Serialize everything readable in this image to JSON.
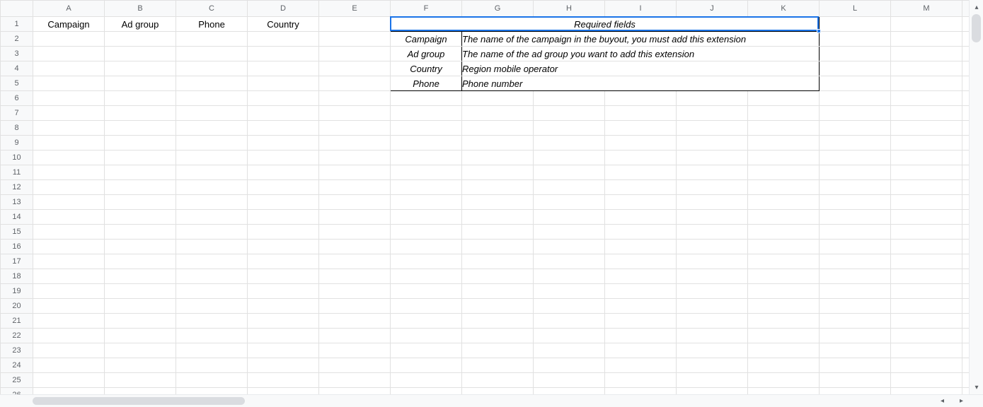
{
  "columns": [
    "A",
    "B",
    "C",
    "D",
    "E",
    "F",
    "G",
    "H",
    "I",
    "J",
    "K",
    "L",
    "M",
    ""
  ],
  "row_count": 26,
  "green_cols": [
    "A",
    "B",
    "C",
    "D"
  ],
  "headers_row1": {
    "A": "Campaign",
    "B": "Ad group",
    "C": "Phone",
    "D": "Country"
  },
  "required": {
    "title": "Required fields",
    "rows": [
      {
        "label": "Campaign",
        "desc": "The name of the campaign in the buyout, you must add this extension"
      },
      {
        "label": "Ad group",
        "desc": "The name of the ad group you want to add this extension"
      },
      {
        "label": "Country",
        "desc": "Region mobile operator"
      },
      {
        "label": "Phone",
        "desc": "Phone number"
      }
    ]
  },
  "selection": {
    "from": "F1",
    "to": "K1"
  },
  "scroll_glyphs": {
    "up": "▴",
    "down": "▾",
    "left": "◂",
    "right": "▸"
  }
}
